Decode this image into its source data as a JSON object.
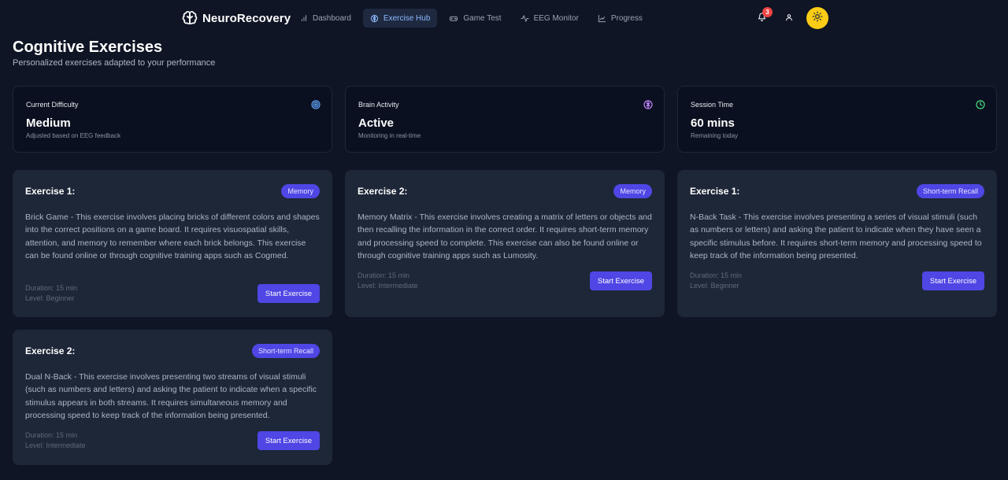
{
  "nav": {
    "brand": "NeuroRecovery",
    "items": [
      {
        "label": "Dashboard",
        "icon": "bar-chart-icon",
        "active": false
      },
      {
        "label": "Exercise Hub",
        "icon": "brain-icon",
        "active": true
      },
      {
        "label": "Game Test",
        "icon": "gamepad-icon",
        "active": false
      },
      {
        "label": "EEG Monitor",
        "icon": "activity-icon",
        "active": false
      },
      {
        "label": "Progress",
        "icon": "line-chart-icon",
        "active": false
      }
    ],
    "notification_count": "3"
  },
  "page": {
    "title": "Cognitive Exercises",
    "subtitle": "Personalized exercises adapted to your performance"
  },
  "stats": [
    {
      "label": "Current Difficulty",
      "value": "Medium",
      "note": "Adjusted based on EEG feedback",
      "icon": "target-icon",
      "color": "#60a5fa"
    },
    {
      "label": "Brain Activity",
      "value": "Active",
      "note": "Monitoring in real-time",
      "icon": "brain-icon",
      "color": "#c084fc"
    },
    {
      "label": "Session Time",
      "value": "60 mins",
      "note": "Remaining today",
      "icon": "clock-icon",
      "color": "#4ade80"
    }
  ],
  "exercises": [
    {
      "title": "Exercise 1:",
      "tag": "Memory",
      "description": "Brick Game - This exercise involves placing bricks of different colors and shapes into the correct positions on a game board. It requires visuospatial skills, attention, and memory to remember where each brick belongs. This exercise can be found online or through cognitive training apps such as Cogmed.",
      "duration": "Duration: 15 min",
      "level": "Level: Beginner",
      "button": "Start Exercise"
    },
    {
      "title": "Exercise 2:",
      "tag": "Memory",
      "description": "Memory Matrix - This exercise involves creating a matrix of letters or objects and then recalling the information in the correct order. It requires short-term memory and processing speed to complete. This exercise can also be found online or through cognitive training apps such as Lumosity.",
      "duration": "Duration: 15 min",
      "level": "Level: Intermediate",
      "button": "Start Exercise"
    },
    {
      "title": "Exercise 1:",
      "tag": "Short-term Recall",
      "description": "N-Back Task - This exercise involves presenting a series of visual stimuli (such as numbers or letters) and asking the patient to indicate when they have seen a specific stimulus before. It requires short-term memory and processing speed to keep track of the information being presented.",
      "duration": "Duration: 15 min",
      "level": "Level: Beginner",
      "button": "Start Exercise"
    },
    {
      "title": "Exercise 2:",
      "tag": "Short-term Recall",
      "description": "Dual N-Back - This exercise involves presenting two streams of visual stimuli (such as numbers and letters) and asking the patient to indicate when a specific stimulus appears in both streams. It requires simultaneous memory and processing speed to keep track of the information being presented.",
      "duration": "Duration: 15 min",
      "level": "Level: Intermediate",
      "button": "Start Exercise"
    }
  ],
  "colors": {
    "background": "#0f1524",
    "card": "#1e2738",
    "accent": "#4f46e5",
    "theme_toggle": "#facc15",
    "badge": "#ef4444"
  }
}
